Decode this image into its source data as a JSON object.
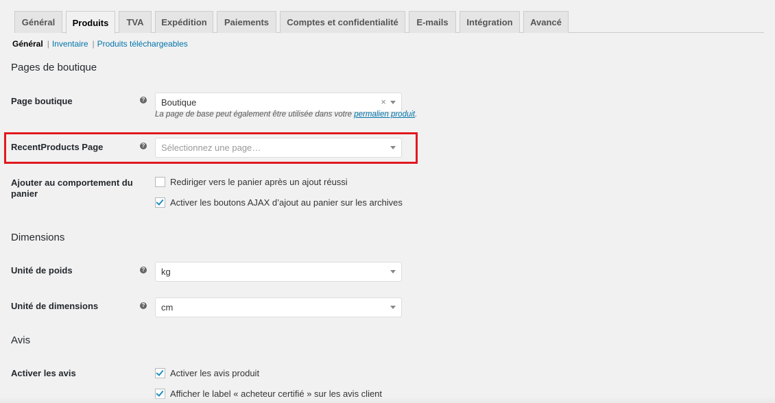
{
  "tabs": [
    {
      "label": "Général"
    },
    {
      "label": "Produits"
    },
    {
      "label": "TVA"
    },
    {
      "label": "Expédition"
    },
    {
      "label": "Paiements"
    },
    {
      "label": "Comptes et confidentialité"
    },
    {
      "label": "E-mails"
    },
    {
      "label": "Intégration"
    },
    {
      "label": "Avancé"
    }
  ],
  "active_tab": "Produits",
  "subnav": {
    "current": "Général",
    "links": [
      "Inventaire",
      "Produits téléchargeables"
    ],
    "separator": "|"
  },
  "sections": {
    "shop_pages": "Pages de boutique",
    "dimensions": "Dimensions",
    "reviews": "Avis"
  },
  "fields": {
    "shop_page": {
      "label": "Page boutique",
      "value": "Boutique",
      "clear": "×",
      "desc_prefix": "La page de base peut également être utilisée dans votre",
      "desc_link": "permalien produit",
      "desc_suffix": "."
    },
    "recent_products_page": {
      "label": "RecentProducts Page",
      "placeholder": "Sélectionnez une page…"
    },
    "cart_behaviour": {
      "label": "Ajouter au comportement du panier",
      "options": [
        {
          "label": "Rediriger vers le panier après un ajout réussi",
          "checked": false
        },
        {
          "label": "Activer les boutons AJAX d’ajout au panier sur les archives",
          "checked": true
        }
      ]
    },
    "weight_unit": {
      "label": "Unité de poids",
      "value": "kg"
    },
    "dimension_unit": {
      "label": "Unité de dimensions",
      "value": "cm"
    },
    "enable_reviews": {
      "label": "Activer les avis",
      "options": [
        {
          "label": "Activer les avis produit",
          "checked": true
        },
        {
          "label": "Afficher le label « acheteur certifié » sur les avis client",
          "checked": true
        }
      ]
    }
  },
  "help_glyph": "?",
  "icons": {
    "help": "question-circle-icon",
    "dropdown": "chevron-down-icon",
    "check": "checkmark-icon"
  },
  "colors": {
    "link": "#0073aa",
    "highlight": "#e0191f",
    "check": "#1e8cbe",
    "background": "#f1f1f1"
  }
}
